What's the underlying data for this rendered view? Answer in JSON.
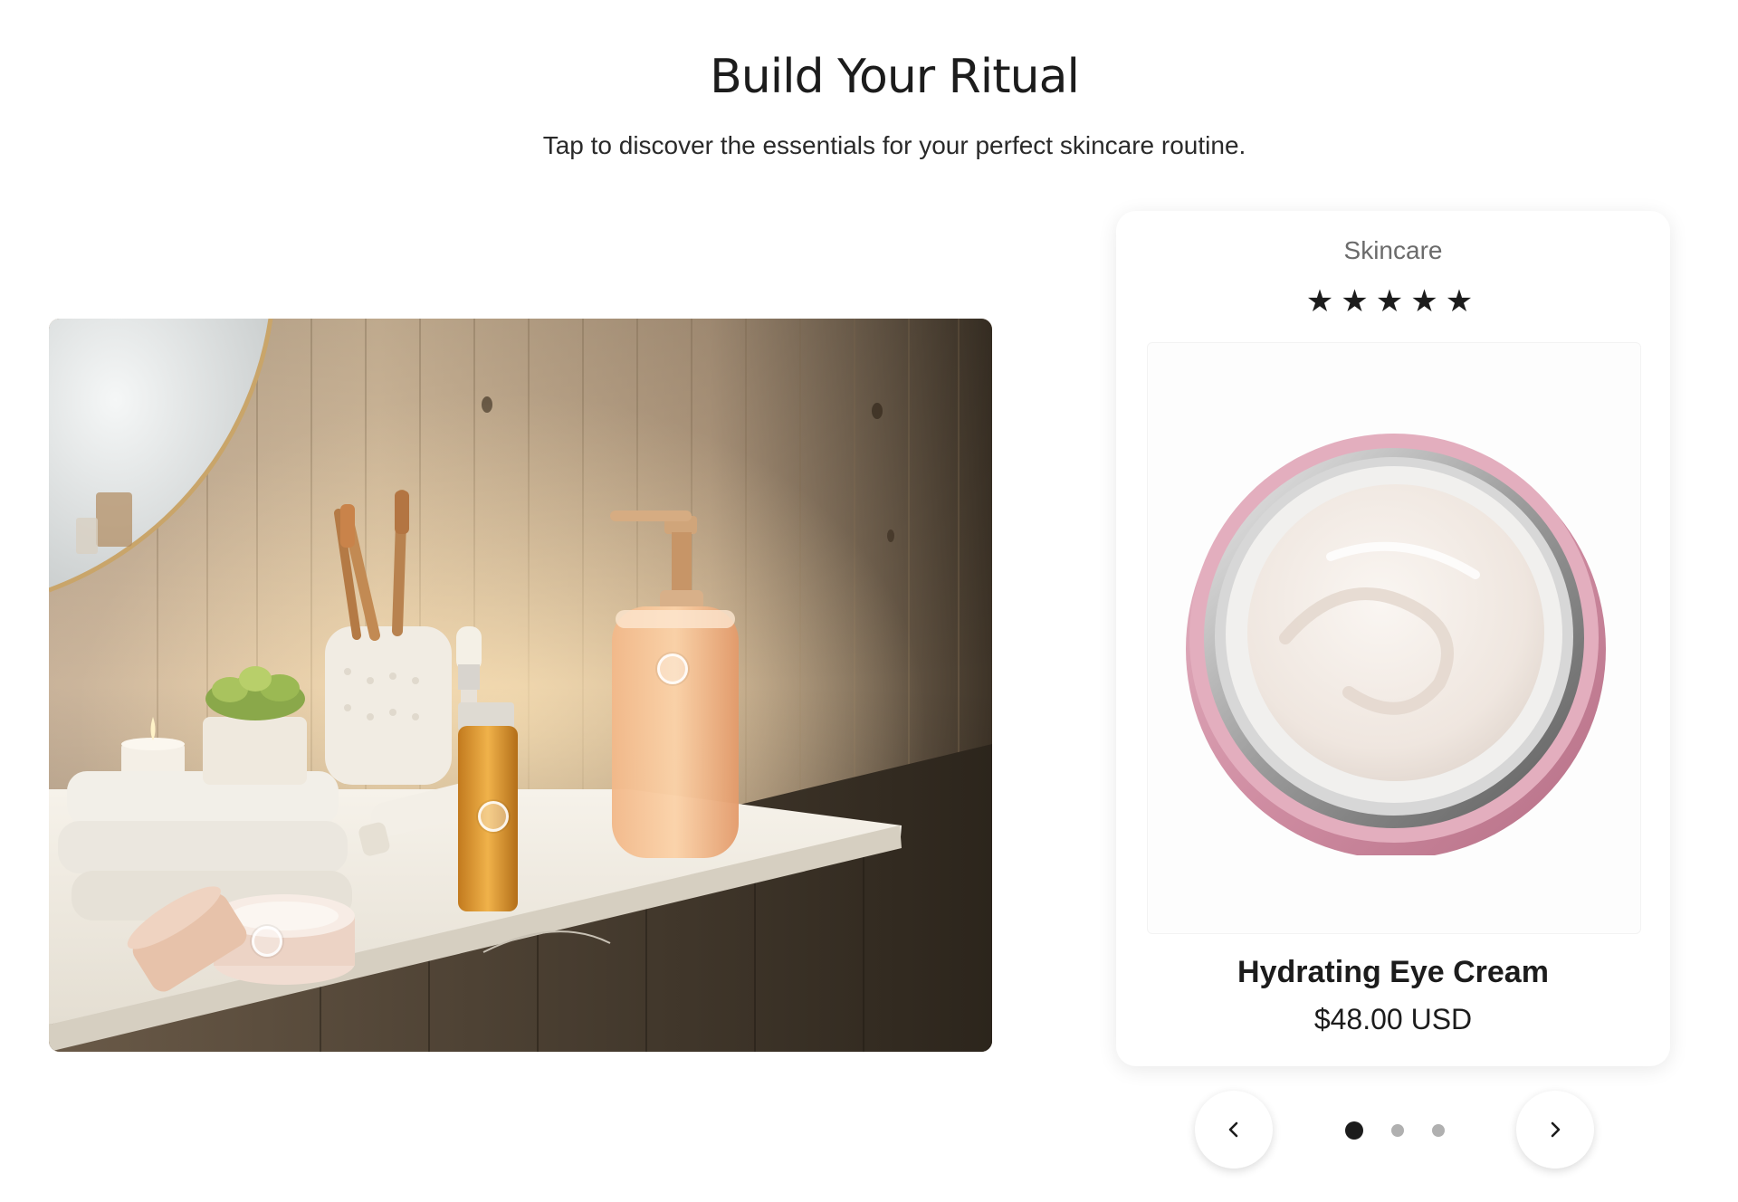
{
  "section": {
    "title": "Build Your Ritual",
    "subtitle": "Tap to discover the essentials for your perfect skincare routine."
  },
  "scene": {
    "hotspot_count": 3
  },
  "product_card": {
    "category": "Skincare",
    "rating": 5,
    "rating_max": 5,
    "stars": "★★★★★",
    "name": "Hydrating Eye Cream",
    "price": "$48.00 USD"
  },
  "carousel": {
    "prev_icon": "chevron-left-icon",
    "next_icon": "chevron-right-icon",
    "active_index": 0,
    "total": 3
  },
  "colors": {
    "text": "#1c1c1c",
    "muted": "#6b6b6b",
    "dot_inactive": "#b0b0b0",
    "jar_pink": "#d9a0b2"
  }
}
